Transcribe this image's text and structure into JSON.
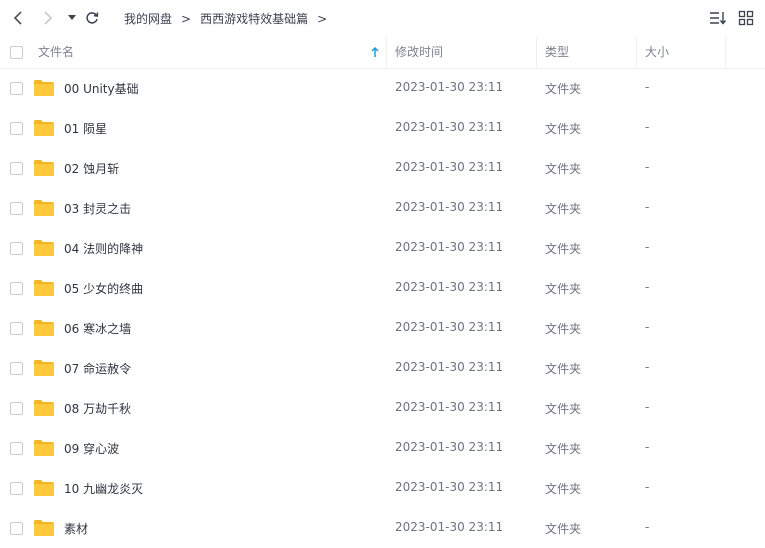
{
  "breadcrumb": {
    "root": "我的网盘",
    "separator": ">",
    "current": "西西游戏特效基础篇",
    "trailing": ">"
  },
  "table": {
    "columns": {
      "name": "文件名",
      "mtime": "修改时间",
      "type": "类型",
      "size": "大小"
    },
    "sort": {
      "column": "name",
      "direction": "ascending",
      "icon": "sort-up-arrow-icon"
    },
    "rows": [
      {
        "name": "00 Unity基础",
        "mtime": "2023-01-30 23:11",
        "type": "文件夹",
        "size": "-"
      },
      {
        "name": "01 陨星",
        "mtime": "2023-01-30 23:11",
        "type": "文件夹",
        "size": "-"
      },
      {
        "name": "02 蚀月斩",
        "mtime": "2023-01-30 23:11",
        "type": "文件夹",
        "size": "-"
      },
      {
        "name": "03 封灵之击",
        "mtime": "2023-01-30 23:11",
        "type": "文件夹",
        "size": "-"
      },
      {
        "name": "04 法则的降神",
        "mtime": "2023-01-30 23:11",
        "type": "文件夹",
        "size": "-"
      },
      {
        "name": "05 少女的终曲",
        "mtime": "2023-01-30 23:11",
        "type": "文件夹",
        "size": "-"
      },
      {
        "name": "06 寒冰之墙",
        "mtime": "2023-01-30 23:11",
        "type": "文件夹",
        "size": "-"
      },
      {
        "name": "07 命运赦令",
        "mtime": "2023-01-30 23:11",
        "type": "文件夹",
        "size": "-"
      },
      {
        "name": "08 万劫千秋",
        "mtime": "2023-01-30 23:11",
        "type": "文件夹",
        "size": "-"
      },
      {
        "name": "09 穿心波",
        "mtime": "2023-01-30 23:11",
        "type": "文件夹",
        "size": "-"
      },
      {
        "name": "10 九幽龙炎灭",
        "mtime": "2023-01-30 23:11",
        "type": "文件夹",
        "size": "-"
      },
      {
        "name": "素材",
        "mtime": "2023-01-30 23:11",
        "type": "文件夹",
        "size": "-"
      }
    ]
  },
  "colors": {
    "folder": "#ffc83d",
    "folder_tab": "#f5b623",
    "sort_arrow": "#1e9bd7",
    "text": "#2f3540",
    "muted": "#6c7380"
  },
  "icons": [
    "back-arrow-icon",
    "forward-arrow-icon",
    "dropdown-caret-icon",
    "refresh-icon",
    "sort-list-icon",
    "grid-view-icon",
    "folder-icon"
  ]
}
